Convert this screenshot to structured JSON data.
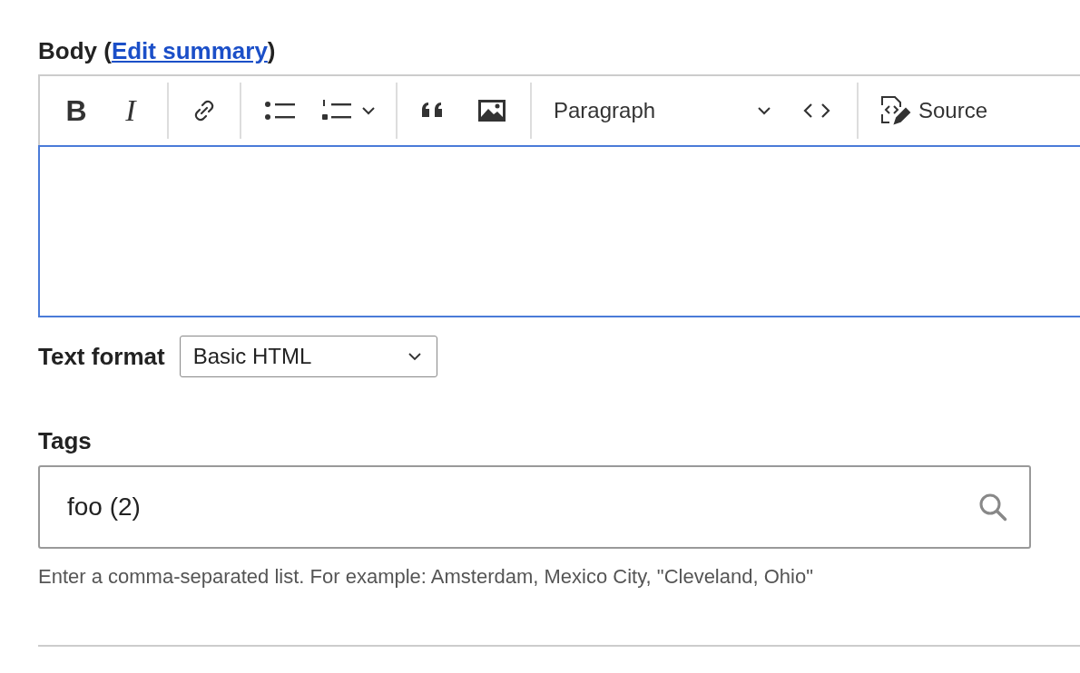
{
  "body": {
    "label": "Body (",
    "link": "Edit summary",
    "label_end": ")",
    "toolbar": [
      {
        "kind": "bold",
        "text": "B"
      },
      {
        "kind": "italic",
        "text": "I"
      },
      {
        "kind": "sep"
      },
      {
        "kind": "link"
      },
      {
        "kind": "sep"
      },
      {
        "kind": "bullets"
      },
      {
        "kind": "numbers"
      },
      {
        "kind": "sep"
      },
      {
        "kind": "quote"
      },
      {
        "kind": "image"
      },
      {
        "kind": "sep"
      },
      {
        "kind": "heading",
        "text": "Paragraph"
      },
      {
        "kind": "code"
      },
      {
        "kind": "sep"
      },
      {
        "kind": "source",
        "text": "Source"
      }
    ],
    "format_label": "Text format",
    "format_value": "Basic HTML"
  },
  "tags": {
    "label": "Tags",
    "value": "foo (2)",
    "help": "Enter a comma-separated list. For example: Amsterdam, Mexico City, \"Cleveland, Ohio\""
  }
}
